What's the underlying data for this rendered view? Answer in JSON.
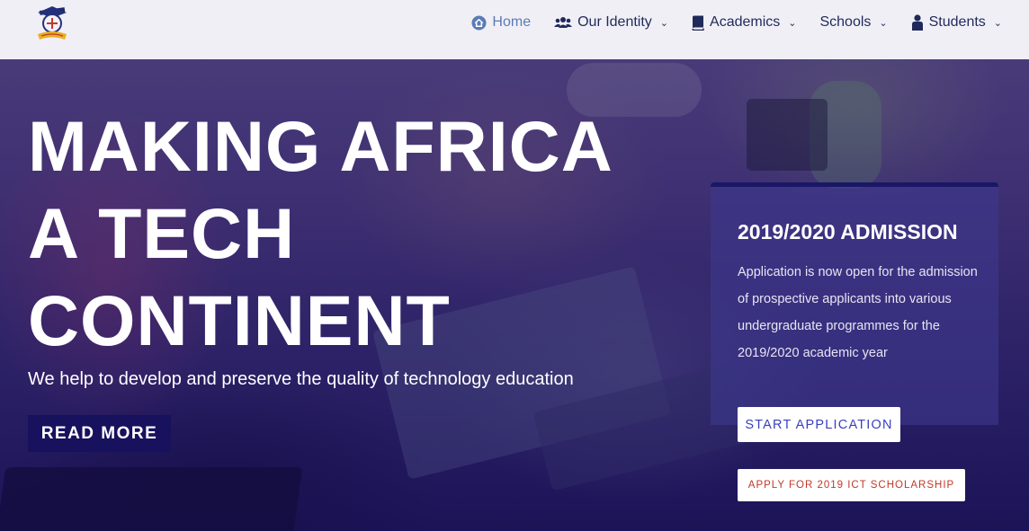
{
  "nav": {
    "items": [
      {
        "label": "Home",
        "icon": "home-icon",
        "active": true
      },
      {
        "label": "Our Identity",
        "icon": "users-icon",
        "dropdown": true
      },
      {
        "label": "Academics",
        "icon": "book-icon",
        "dropdown": true
      },
      {
        "label": "Schools",
        "dropdown": true
      },
      {
        "label": "Students",
        "icon": "student-icon",
        "dropdown": true
      }
    ]
  },
  "hero": {
    "headline": [
      "MAKING AFRICA",
      "A TECH",
      "CONTINENT"
    ],
    "tagline": "We help to develop and preserve the quality of technology education",
    "cta_label": "READ MORE"
  },
  "admission": {
    "title": "2019/2020 ADMISSION",
    "text": "Application is now open for the admission of prospective applicants into various undergraduate programmes for the 2019/2020 academic year",
    "start_label": "START APPLICATION",
    "scholarship_label": "APPLY FOR 2019 ICT SCHOLARSHIP"
  },
  "colors": {
    "nav_text": "#1f2a5a",
    "nav_active": "#5a7cb6",
    "cta_background": "#17115e",
    "start_button_text": "#3a3fc0",
    "scholarship_button_text": "#c0392b"
  }
}
